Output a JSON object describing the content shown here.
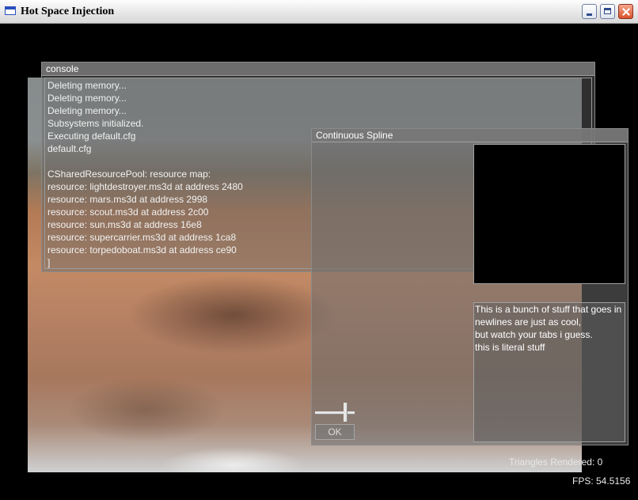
{
  "window": {
    "title": "Hot Space Injection",
    "icon": "app-window-icon",
    "buttons": [
      "minimize",
      "maximize",
      "close"
    ]
  },
  "console": {
    "title": "console",
    "lines": [
      "Deleting memory...",
      "Deleting memory...",
      "Deleting memory...",
      "Subsystems initialized.",
      "Executing default.cfg",
      "default.cfg",
      "",
      "CSharedResourcePool: resource map:",
      "resource: lightdestroyer.ms3d at address 2480",
      "resource: mars.ms3d at address 2998",
      "resource: scout.ms3d at address 2c00",
      "resource: sun.ms3d at address 16e8",
      "resource: supercarrier.ms3d at address 1ca8",
      "resource: torpedoboat.ms3d at address ce90",
      "]"
    ]
  },
  "spline": {
    "title": "Continuous Spline",
    "text_lines": [
      "This is a bunch of stuff that goes in",
      "newlines are just as cool,",
      "but watch your tabs i guess.",
      "this is literal stuff"
    ],
    "ok_label": "OK",
    "slider_level": 0.75
  },
  "hud": {
    "triangles": "Triangles Rendered: 0",
    "fps": "FPS: 54.5156"
  },
  "colors": {
    "titlebar_top": "#fdfdfd",
    "titlebar_bottom": "#d8d8d8",
    "panel_text": "#f2f2f2",
    "viewport_bg": "#000000"
  }
}
